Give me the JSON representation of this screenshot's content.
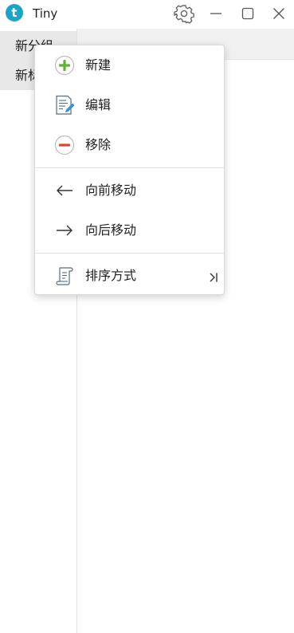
{
  "app": {
    "logo_letter": "t",
    "title": "Tiny"
  },
  "window_controls": {
    "settings_icon": "gear-icon",
    "minimize_icon": "minimize-icon",
    "maximize_icon": "maximize-icon",
    "close_icon": "close-icon"
  },
  "sidebar": {
    "items": [
      {
        "label": "新分组"
      },
      {
        "label": "新标"
      }
    ]
  },
  "context_menu": {
    "items": [
      {
        "label": "新建",
        "icon": "plus-circle-icon",
        "color": "#5cb531"
      },
      {
        "label": "编辑",
        "icon": "document-edit-icon",
        "color": "#3a8fd8"
      },
      {
        "label": "移除",
        "icon": "minus-circle-icon",
        "color": "#e0433a"
      },
      {
        "label": "向前移动",
        "icon": "arrow-left-icon"
      },
      {
        "label": "向后移动",
        "icon": "arrow-right-icon"
      },
      {
        "label": "排序方式",
        "icon": "scroll-icon",
        "submenu_icon": "chevron-right-bar-icon"
      }
    ]
  },
  "colors": {
    "accent": "#1aa4c7",
    "sidebar_selected": "#e8e8e8",
    "header_bg": "#f0f0f0"
  }
}
